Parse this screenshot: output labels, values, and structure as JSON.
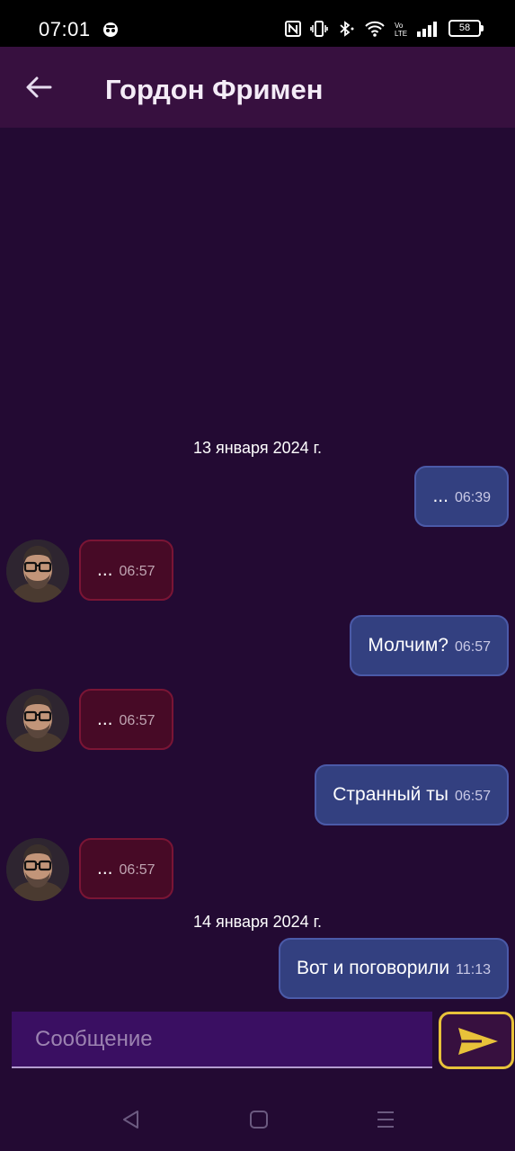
{
  "status_bar": {
    "time": "07:01",
    "battery": "58"
  },
  "chat": {
    "title": "Гордон Фримен"
  },
  "messages": [
    {
      "type": "date",
      "text": "13 января 2024 г."
    },
    {
      "type": "out",
      "text": "...",
      "time": "06:39"
    },
    {
      "type": "in",
      "text": "...",
      "time": "06:57"
    },
    {
      "type": "out",
      "text": "Молчим?",
      "time": "06:57"
    },
    {
      "type": "in",
      "text": "...",
      "time": "06:57"
    },
    {
      "type": "out",
      "text": "Странный ты",
      "time": "06:57"
    },
    {
      "type": "in",
      "text": "...",
      "time": "06:57"
    },
    {
      "type": "date",
      "text": "14 января 2024 г."
    },
    {
      "type": "out",
      "text": "Вот и поговорили",
      "time": "11:13"
    }
  ],
  "composer": {
    "placeholder": "Сообщение",
    "value": ""
  },
  "icons": {
    "back": "arrow-left-icon",
    "send": "send-icon",
    "nav_back": "triangle-back-icon",
    "nav_home": "square-home-icon",
    "nav_menu": "menu-lines-icon"
  },
  "colors": {
    "background": "#230a33",
    "app_bar": "#37103f",
    "outgoing_bubble": "#334080",
    "incoming_bubble": "#470a26",
    "send_accent": "#e8c23a"
  }
}
